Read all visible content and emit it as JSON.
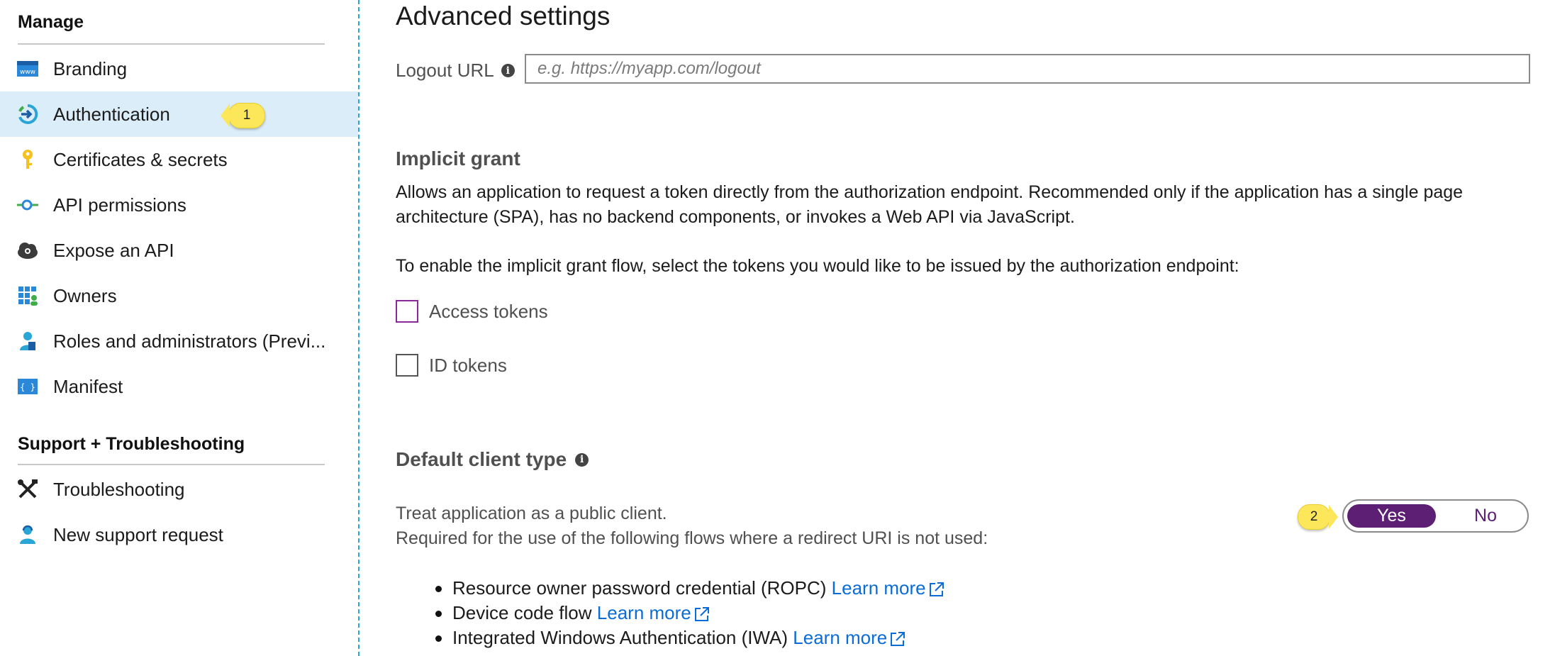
{
  "sidebar": {
    "manage_header": "Manage",
    "items": [
      {
        "label": "Branding",
        "icon": "branding-www-icon"
      },
      {
        "label": "Authentication",
        "icon": "authentication-icon"
      },
      {
        "label": "Certificates & secrets",
        "icon": "key-icon"
      },
      {
        "label": "API permissions",
        "icon": "api-permissions-icon"
      },
      {
        "label": "Expose an API",
        "icon": "cloud-gear-icon"
      },
      {
        "label": "Owners",
        "icon": "owners-grid-icon"
      },
      {
        "label": "Roles and administrators (Previ...",
        "icon": "roles-icon"
      },
      {
        "label": "Manifest",
        "icon": "manifest-icon"
      }
    ],
    "support_header": "Support + Troubleshooting",
    "support_items": [
      {
        "label": "Troubleshooting",
        "icon": "wrench-screwdriver-icon"
      },
      {
        "label": "New support request",
        "icon": "support-person-icon"
      }
    ],
    "selected": "Authentication",
    "callout_1": "1"
  },
  "main": {
    "title": "Advanced settings",
    "logout": {
      "label": "Logout URL",
      "placeholder": "e.g. https://myapp.com/logout",
      "value": ""
    },
    "implicit": {
      "heading": "Implicit grant",
      "description": "Allows an application to request a token directly from the authorization endpoint. Recommended only if the application has a single page architecture (SPA), has no backend components, or invokes a Web API via JavaScript.",
      "instruction": "To enable the implicit grant flow, select the tokens you would like to be issued by the authorization endpoint:",
      "access_tokens": {
        "label": "Access tokens",
        "checked": false
      },
      "id_tokens": {
        "label": "ID tokens",
        "checked": false
      }
    },
    "client_type": {
      "heading": "Default client type",
      "line1": "Treat application as a public client.",
      "line2": "Required for the use of the following flows where a redirect URI is not used:",
      "toggle": {
        "yes": "Yes",
        "no": "No",
        "selected": "Yes"
      },
      "callout_2": "2",
      "flows": [
        {
          "text": "Resource owner password credential (ROPC)",
          "link": "Learn more"
        },
        {
          "text": "Device code flow",
          "link": "Learn more"
        },
        {
          "text": "Integrated Windows Authentication (IWA)",
          "link": "Learn more"
        }
      ]
    }
  },
  "colors": {
    "accent": "#5c1f74",
    "link": "#0a6cd6",
    "selected_bg": "#dcedfa",
    "callout": "#fce75a",
    "divider": "#2aa6d6"
  }
}
